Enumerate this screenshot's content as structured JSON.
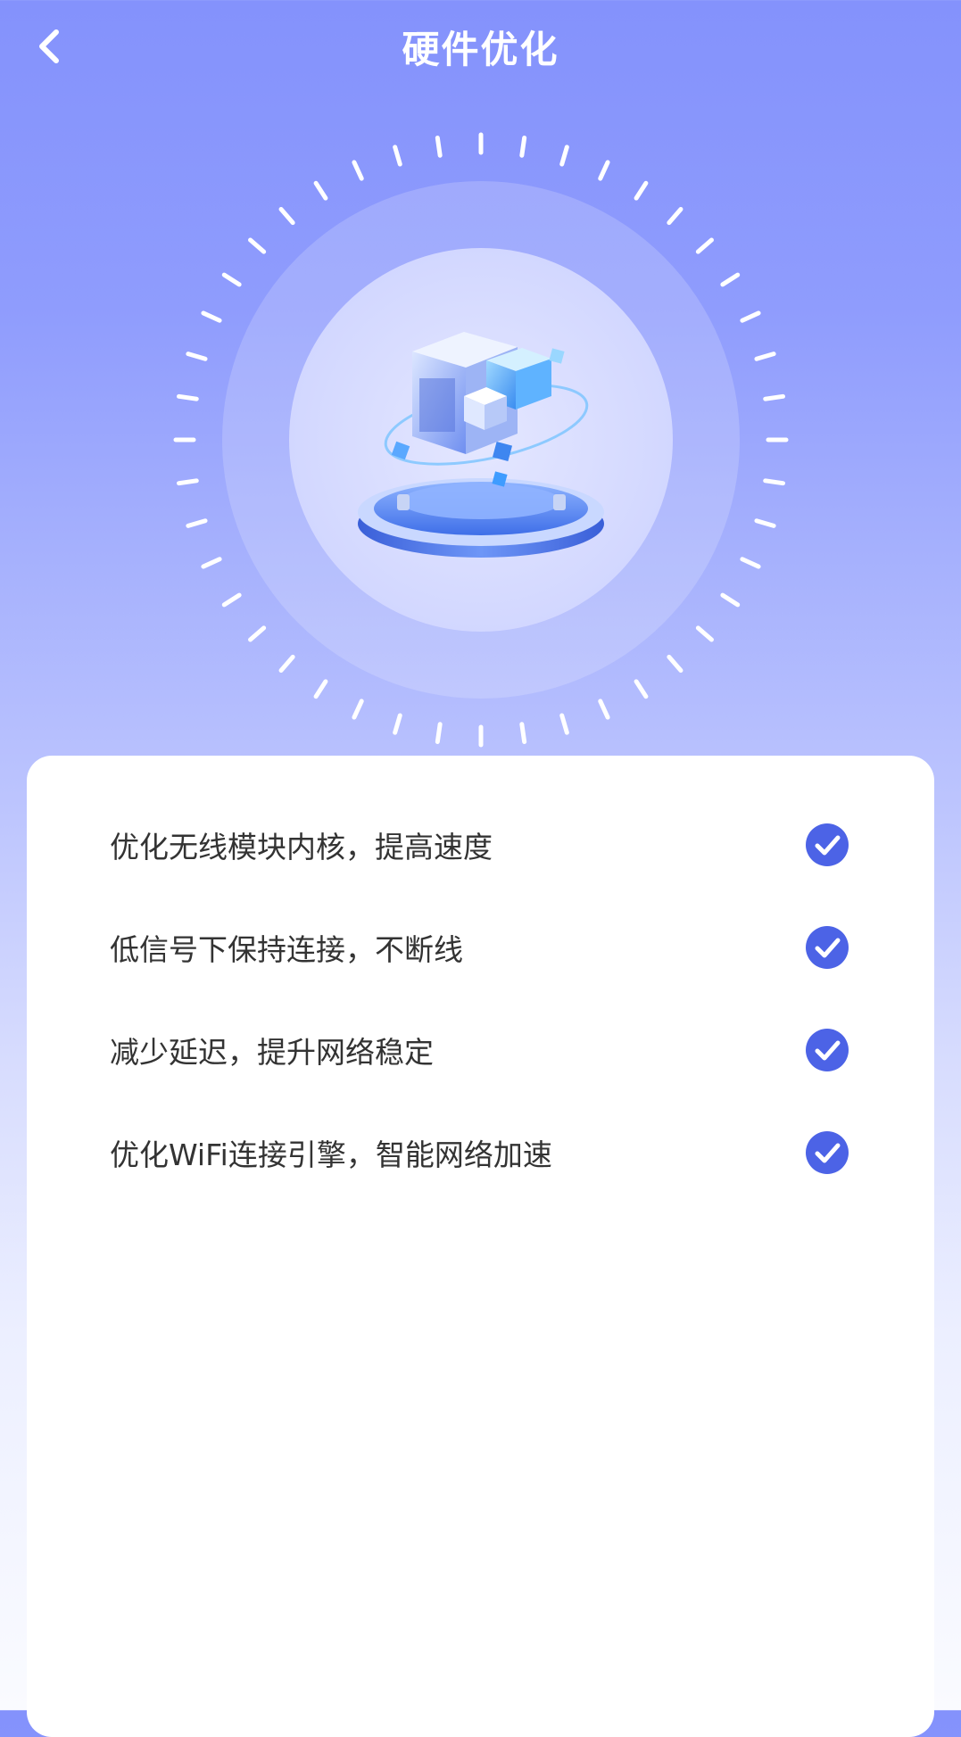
{
  "header": {
    "title": "硬件优化",
    "back_icon": "chevron-left-icon"
  },
  "colors": {
    "accent": "#4c63e6",
    "text": "#333333",
    "bg_top": "#8492fc",
    "bg_bottom": "#fafbff"
  },
  "hero": {
    "illustration": "hardware-cube-platform-icon"
  },
  "features": [
    {
      "label": "优化无线模块内核，提高速度",
      "status_icon": "check-circle-icon"
    },
    {
      "label": "低信号下保持连接，不断线",
      "status_icon": "check-circle-icon"
    },
    {
      "label": "减少延迟，提升网络稳定",
      "status_icon": "check-circle-icon"
    },
    {
      "label": "优化WiFi连接引擎，智能网络加速",
      "status_icon": "check-circle-icon"
    }
  ]
}
